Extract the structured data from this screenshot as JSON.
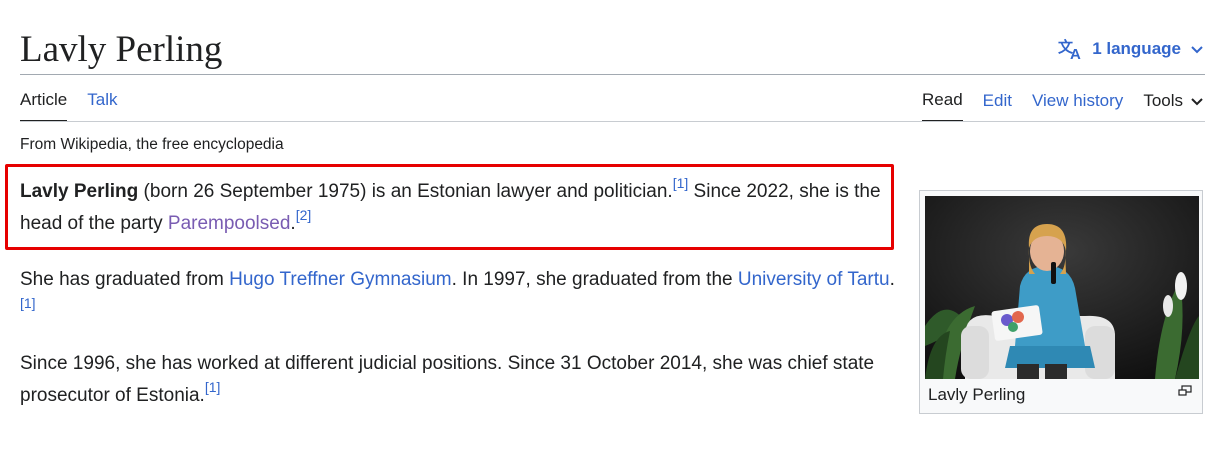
{
  "page": {
    "title": "Lavly Perling",
    "language_label": "1 language",
    "tagline": "From Wikipedia, the free encyclopedia"
  },
  "tabs_left": [
    {
      "label": "Article",
      "selected": true
    },
    {
      "label": "Talk",
      "selected": false
    }
  ],
  "tabs_right": [
    {
      "label": "Read",
      "selected": true
    },
    {
      "label": "Edit",
      "selected": false
    },
    {
      "label": "View history",
      "selected": false
    },
    {
      "label": "Tools",
      "selected": false
    }
  ],
  "article": {
    "p1": {
      "bold_name": "Lavly Perling",
      "text_a": " (born 26 September 1975) is an Estonian lawyer and politician.",
      "ref_a": "[1]",
      "text_b": " Since 2022, she is the head of the party ",
      "link": "Parempoolsed",
      "text_c": ".",
      "ref_b": "[2]"
    },
    "p2": {
      "text_a": "She has graduated from ",
      "link_a": "Hugo Treffner Gymnasium",
      "text_b": ". In 1997, she graduated from the ",
      "link_b": "University of Tartu",
      "text_c": ".",
      "ref": "[1]"
    },
    "p3": {
      "text": "Since 1996, she has worked at different judicial positions. Since 31 October 2014, she was chief state prosecutor of Estonia.",
      "ref": "[1]"
    }
  },
  "infobox": {
    "caption": "Lavly Perling"
  },
  "colors": {
    "link": "#3366cc",
    "visited_link": "#795cb2",
    "highlight_border": "#e60000"
  },
  "icons": [
    "translate-icon",
    "chevron-down-icon",
    "enlarge-icon"
  ]
}
